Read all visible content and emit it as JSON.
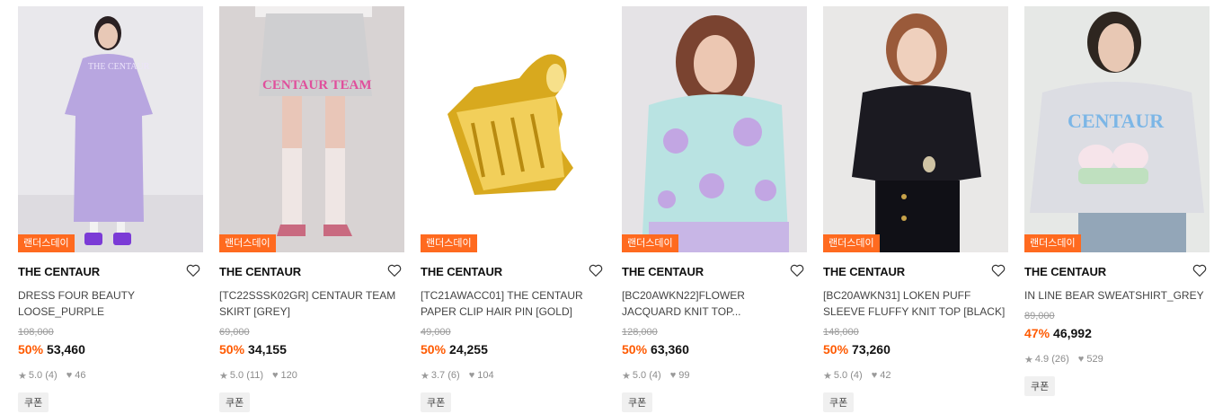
{
  "products": [
    {
      "tag": "랜더스데이",
      "brand": "THE CENTAUR",
      "title": "DRESS FOUR BEAUTY LOOSE_PURPLE",
      "original_price": "108,000",
      "discount": "50%",
      "price": "53,460",
      "rating": "5.0",
      "reviews": "(4)",
      "likes": "46",
      "coupon": "쿠폰"
    },
    {
      "tag": "랜더스데이",
      "brand": "THE CENTAUR",
      "title": "[TC22SSSK02GR] CENTAUR TEAM SKIRT [GREY]",
      "original_price": "69,000",
      "discount": "50%",
      "price": "34,155",
      "rating": "5.0",
      "reviews": "(11)",
      "likes": "120",
      "coupon": "쿠폰"
    },
    {
      "tag": "랜더스데이",
      "brand": "THE CENTAUR",
      "title": "[TC21AWACC01] THE CENTAUR PAPER CLIP HAIR PIN [GOLD]",
      "original_price": "49,000",
      "discount": "50%",
      "price": "24,255",
      "rating": "3.7",
      "reviews": "(6)",
      "likes": "104",
      "coupon": "쿠폰"
    },
    {
      "tag": "랜더스데이",
      "brand": "THE CENTAUR",
      "title": "[BC20AWKN22]FLOWER JACQUARD KNIT TOP...",
      "original_price": "128,000",
      "discount": "50%",
      "price": "63,360",
      "rating": "5.0",
      "reviews": "(4)",
      "likes": "99",
      "coupon": "쿠폰"
    },
    {
      "tag": "랜더스데이",
      "brand": "THE CENTAUR",
      "title": "[BC20AWKN31] LOKEN PUFF SLEEVE FLUFFY KNIT TOP [BLACK]",
      "original_price": "148,000",
      "discount": "50%",
      "price": "73,260",
      "rating": "5.0",
      "reviews": "(4)",
      "likes": "42",
      "coupon": "쿠폰"
    },
    {
      "tag": "랜더스데이",
      "brand": "THE CENTAUR",
      "title": "IN LINE BEAR SWEATSHIRT_GREY",
      "original_price": "89,000",
      "discount": "47%",
      "price": "46,992",
      "rating": "4.9",
      "reviews": "(26)",
      "likes": "529",
      "coupon": "쿠폰"
    }
  ],
  "icons": {
    "wishlist": "heart-outline-icon",
    "rating": "star-icon",
    "likes": "heart-filled-icon"
  },
  "colors": {
    "tag_bg": "#ff6a1f",
    "discount": "#ff5a00"
  }
}
